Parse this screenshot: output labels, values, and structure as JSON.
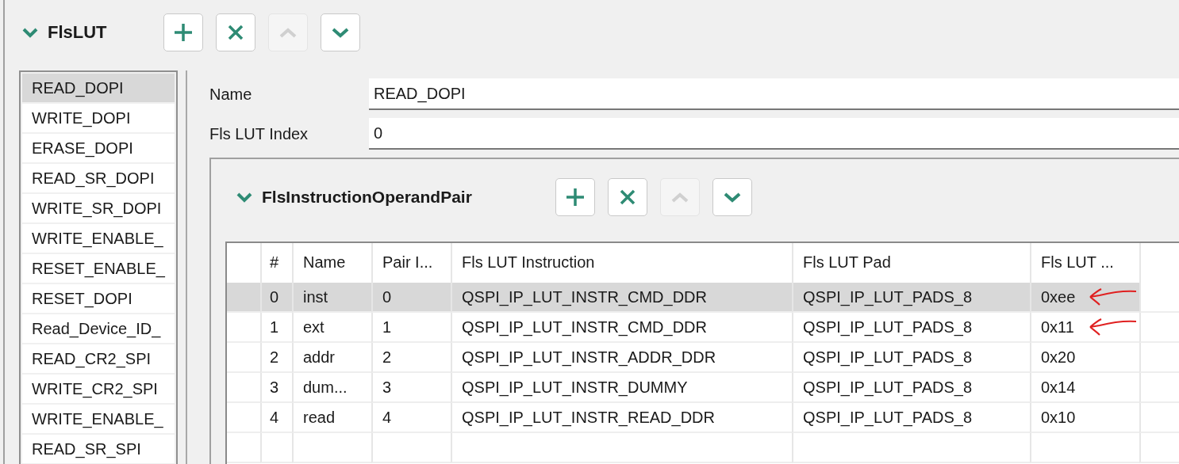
{
  "section": {
    "title": "FlsLUT",
    "expanded": true,
    "buttons": [
      {
        "kind": "add",
        "disabled": false
      },
      {
        "kind": "remove",
        "disabled": false
      },
      {
        "kind": "up",
        "disabled": true
      },
      {
        "kind": "down",
        "disabled": false
      }
    ]
  },
  "list": [
    {
      "label": "READ_DOPI",
      "selected": true
    },
    {
      "label": "WRITE_DOPI",
      "selected": false
    },
    {
      "label": "ERASE_DOPI",
      "selected": false
    },
    {
      "label": "READ_SR_DOPI",
      "selected": false
    },
    {
      "label": "WRITE_SR_DOPI",
      "selected": false
    },
    {
      "label": "WRITE_ENABLE_",
      "selected": false
    },
    {
      "label": "RESET_ENABLE_",
      "selected": false
    },
    {
      "label": "RESET_DOPI",
      "selected": false
    },
    {
      "label": "Read_Device_ID_",
      "selected": false
    },
    {
      "label": "READ_CR2_SPI",
      "selected": false
    },
    {
      "label": "WRITE_CR2_SPI",
      "selected": false
    },
    {
      "label": "WRITE_ENABLE_",
      "selected": false
    },
    {
      "label": "READ_SR_SPI",
      "selected": false
    }
  ],
  "form": [
    {
      "label": "Name",
      "value": "READ_DOPI"
    },
    {
      "label": "Fls LUT Index",
      "value": "0"
    }
  ],
  "subsection": {
    "title": "FlsInstructionOperandPair",
    "expanded": true,
    "buttons": [
      {
        "kind": "add",
        "disabled": false
      },
      {
        "kind": "remove",
        "disabled": false
      },
      {
        "kind": "up",
        "disabled": true
      },
      {
        "kind": "down",
        "disabled": false
      }
    ]
  },
  "table": {
    "columns": [
      "#",
      "Name",
      "Pair I...",
      "Fls LUT Instruction",
      "Fls LUT Pad",
      "Fls LUT ..."
    ],
    "rows": [
      {
        "cells": [
          "0",
          "inst",
          "0",
          "QSPI_IP_LUT_INSTR_CMD_DDR",
          "QSPI_IP_LUT_PADS_8",
          "0xee"
        ],
        "selected": true,
        "marked": true
      },
      {
        "cells": [
          "1",
          "ext",
          "1",
          "QSPI_IP_LUT_INSTR_CMD_DDR",
          "QSPI_IP_LUT_PADS_8",
          "0x11"
        ],
        "selected": false,
        "marked": true
      },
      {
        "cells": [
          "2",
          "addr",
          "2",
          "QSPI_IP_LUT_INSTR_ADDR_DDR",
          "QSPI_IP_LUT_PADS_8",
          "0x20"
        ],
        "selected": false,
        "marked": false
      },
      {
        "cells": [
          "3",
          "dum...",
          "3",
          "QSPI_IP_LUT_INSTR_DUMMY",
          "QSPI_IP_LUT_PADS_8",
          "0x14"
        ],
        "selected": false,
        "marked": false
      },
      {
        "cells": [
          "4",
          "read",
          "4",
          "QSPI_IP_LUT_INSTR_READ_DDR",
          "QSPI_IP_LUT_PADS_8",
          "0x10"
        ],
        "selected": false,
        "marked": false
      }
    ]
  }
}
